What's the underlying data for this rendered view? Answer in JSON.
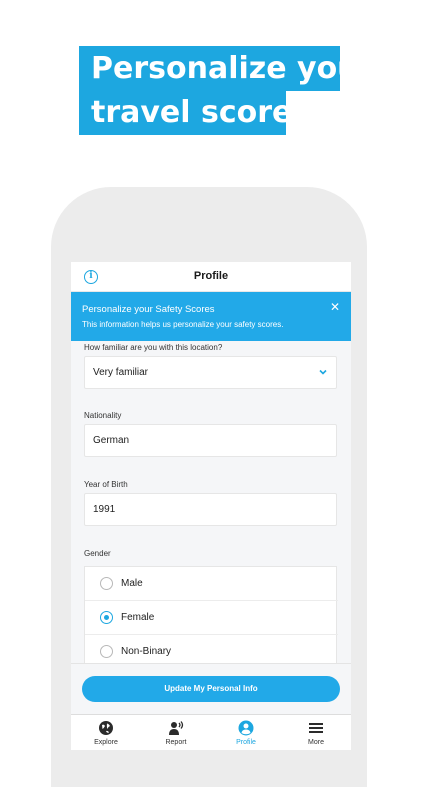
{
  "headline": {
    "line1": "Personalize your",
    "line2": "travel scores"
  },
  "header": {
    "title": "Profile",
    "info_icon": "info-icon"
  },
  "banner": {
    "title": "Personalize your Safety Scores",
    "subtitle": "This information helps us personalize your safety scores.",
    "close_icon": "close-icon"
  },
  "form": {
    "familiarity": {
      "label": "How familiar are you with this location?",
      "value": "Very familiar"
    },
    "nationality": {
      "label": "Nationality",
      "value": "German"
    },
    "birth_year": {
      "label": "Year of Birth",
      "value": "1991"
    },
    "gender": {
      "label": "Gender",
      "options": [
        {
          "label": "Male",
          "selected": false
        },
        {
          "label": "Female",
          "selected": true
        },
        {
          "label": "Non-Binary",
          "selected": false
        }
      ]
    }
  },
  "update_button": "Update My Personal Info",
  "tabs": [
    {
      "label": "Explore",
      "icon": "globe-icon",
      "active": false
    },
    {
      "label": "Report",
      "icon": "report-speaker-icon",
      "active": false
    },
    {
      "label": "Profile",
      "icon": "profile-icon",
      "active": true
    },
    {
      "label": "More",
      "icon": "menu-icon",
      "active": false
    }
  ],
  "colors": {
    "accent": "#1da7e0",
    "banner": "#22a9e8"
  }
}
